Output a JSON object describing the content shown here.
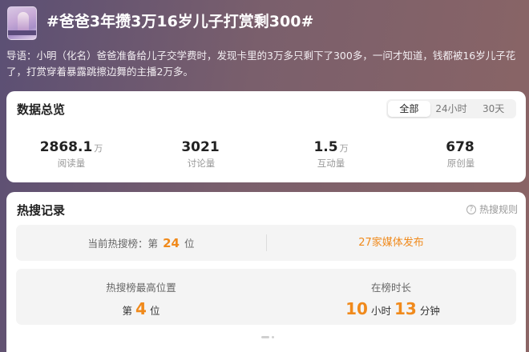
{
  "header": {
    "title": "#爸爸3年攒3万16岁儿子打赏剩300#",
    "intro": "导语：小明（化名）爸爸准备给儿子交学费时，发现卡里的3万多只剩下了300多，一问才知道，钱都被16岁儿子花了，打赏穿着暴露跳擦边舞的主播2万多。"
  },
  "overview": {
    "title": "数据总览",
    "tabs": [
      {
        "label": "全部",
        "active": true
      },
      {
        "label": "24小时",
        "active": false
      },
      {
        "label": "30天",
        "active": false
      }
    ],
    "stats": [
      {
        "value": "2868.1",
        "unit": "万",
        "label": "阅读量"
      },
      {
        "value": "3021",
        "unit": "",
        "label": "讨论量"
      },
      {
        "value": "1.5",
        "unit": "万",
        "label": "互动量"
      },
      {
        "value": "678",
        "unit": "",
        "label": "原创量"
      }
    ]
  },
  "hot": {
    "title": "热搜记录",
    "rules_label": "热搜规则",
    "rules_icon": "question-circle-icon",
    "current_rank": {
      "prefix": "当前热搜榜：第",
      "value": "24",
      "suffix": "位"
    },
    "media": "27家媒体发布",
    "best": {
      "label": "热搜榜最高位置",
      "prefix": "第",
      "value": "4",
      "suffix": "位"
    },
    "duration": {
      "label": "在榜时长",
      "hours": "10",
      "hours_unit": "小时",
      "minutes": "13",
      "minutes_unit": "分钟"
    },
    "accent_color": "#f08a1c"
  }
}
